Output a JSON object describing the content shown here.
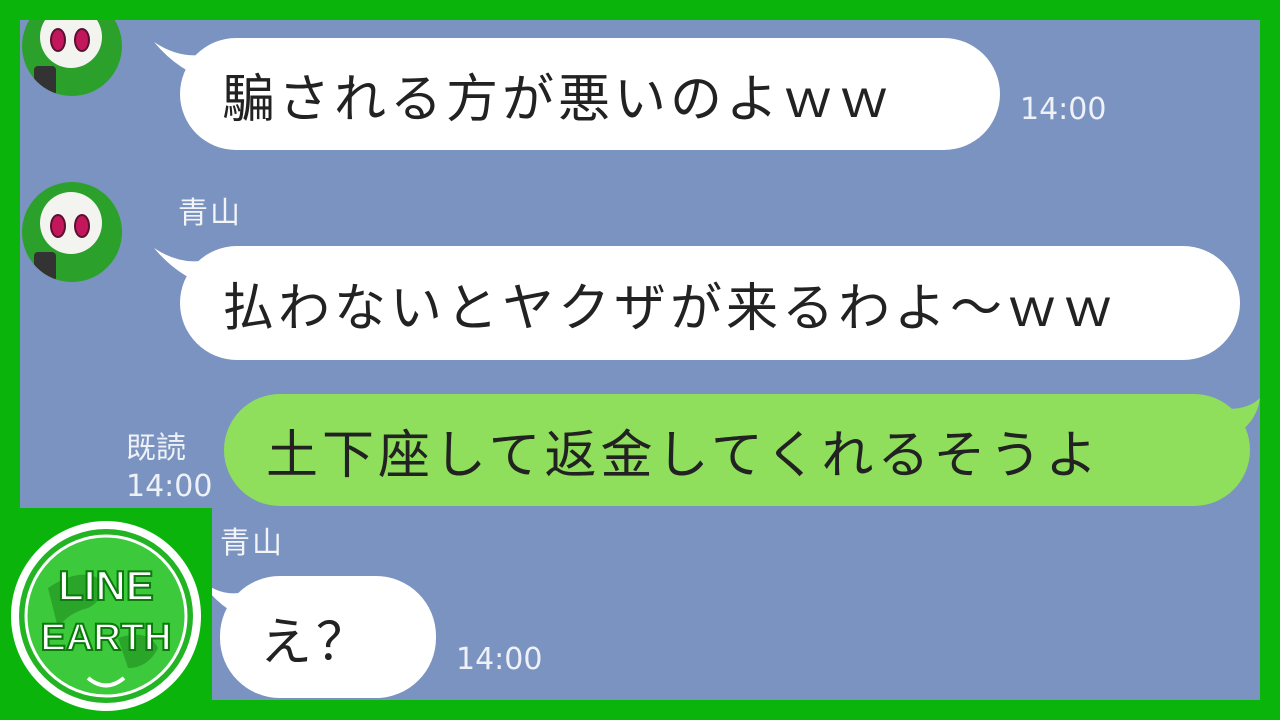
{
  "messages": [
    {
      "type": "incoming",
      "text": "騙される方が悪いのよｗｗ",
      "time": "14:00"
    },
    {
      "type": "incoming",
      "sender": "青山",
      "text": "払わないとヤクザが来るわよ〜ｗｗ"
    },
    {
      "type": "outgoing",
      "text": "土下座して返金してくれるそうよ",
      "read_label": "既読",
      "time": "14:00"
    },
    {
      "type": "incoming",
      "sender": "青山",
      "text": "え？",
      "time": "14:00"
    }
  ],
  "logo": {
    "line1": "LINE",
    "line2": "EARTH"
  },
  "colors": {
    "background": "#7b93c0",
    "incoming": "#ffffff",
    "outgoing": "#8fdf5c",
    "frame": "#0bb40b"
  }
}
